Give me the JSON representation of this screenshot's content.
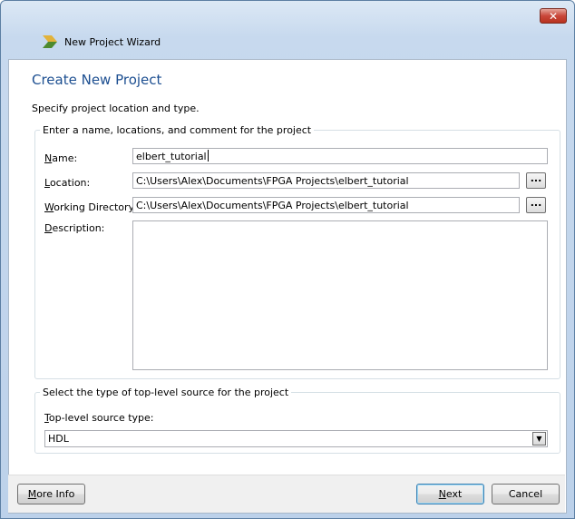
{
  "window": {
    "title": "New Project Wizard",
    "close_glyph": "✕",
    "icon": "xilinx-wizard-icon"
  },
  "page": {
    "heading": "Create New Project",
    "subheading": "Specify project location and type."
  },
  "project_group": {
    "legend": "Enter a name, locations, and comment for the project",
    "name_label_accel": "N",
    "name_label_rest": "ame:",
    "name_value": "elbert_tutorial",
    "location_label_accel": "L",
    "location_label_rest": "ocation:",
    "location_value": "C:\\Users\\Alex\\Documents\\FPGA Projects\\elbert_tutorial",
    "workdir_label_accel": "W",
    "workdir_label_rest": "orking Directory:",
    "workdir_value": "C:\\Users\\Alex\\Documents\\FPGA Projects\\elbert_tutorial",
    "description_label_accel": "D",
    "description_label_rest": "escription:",
    "description_value": "",
    "browse_label": "..."
  },
  "source_group": {
    "legend": "Select the type of top-level source for the project",
    "type_label_accel": "T",
    "type_label_rest": "op-level source type:",
    "type_selected": "HDL",
    "dropdown_glyph": "▼"
  },
  "footer": {
    "more_info_accel": "M",
    "more_info_rest": "ore Info",
    "next_accel": "N",
    "next_rest": "ext",
    "cancel_label": "Cancel"
  },
  "colors": {
    "heading": "#1d4f91",
    "frame": "#c7d9ee",
    "close": "#c9473a"
  }
}
